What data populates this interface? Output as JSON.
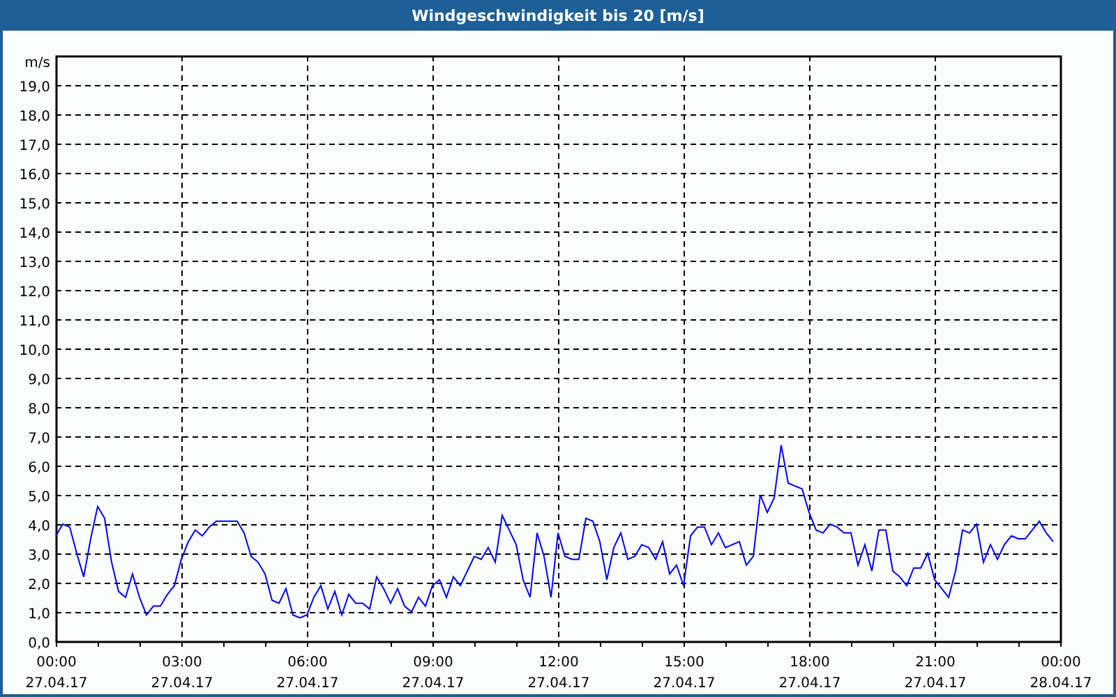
{
  "window": {
    "title": "Windgeschwindigkeit bis 20 [m/s]"
  },
  "chart": {
    "chart_data": {
      "type": "line",
      "grid": true,
      "ylabel": "m/s",
      "ylim": [
        0,
        20
      ],
      "categories": [
        "00:00 27.04.17",
        null,
        null,
        null,
        null,
        null,
        null,
        null,
        null,
        null,
        null,
        null,
        null,
        null,
        null,
        null,
        null,
        null,
        "03:00 27.04.17",
        null,
        null,
        null,
        null,
        null,
        null,
        null,
        null,
        null,
        null,
        null,
        null,
        null,
        null,
        null,
        null,
        null,
        "06:00 27.04.17",
        null,
        null,
        null,
        null,
        null,
        null,
        null,
        null,
        null,
        null,
        null,
        null,
        null,
        null,
        null,
        null,
        null,
        "09:00 27.04.17",
        null,
        null,
        null,
        null,
        null,
        null,
        null,
        null,
        null,
        null,
        null,
        null,
        null,
        null,
        null,
        null,
        null,
        "12:00 27.04.17",
        null,
        null,
        null,
        null,
        null,
        null,
        null,
        null,
        null,
        null,
        null,
        null,
        null,
        null,
        null,
        null,
        null,
        "15:00 27.04.17",
        null,
        null,
        null,
        null,
        null,
        null,
        null,
        null,
        null,
        null,
        null,
        null,
        null,
        null,
        null,
        null,
        null,
        "18:00 27.04.17",
        null,
        null,
        null,
        null,
        null,
        null,
        null,
        null,
        null,
        null,
        null,
        null,
        null,
        null,
        null,
        null,
        null,
        "21:00 27.04.17",
        null,
        null,
        null,
        null,
        null,
        null,
        null,
        null,
        null,
        null,
        null,
        null,
        null,
        null,
        null,
        null,
        null,
        "00:00 28.04.17"
      ],
      "yticks": [
        {
          "value": 0,
          "label": "0,0"
        },
        {
          "value": 1,
          "label": "1,0"
        },
        {
          "value": 2,
          "label": "2,0"
        },
        {
          "value": 3,
          "label": "3,0"
        },
        {
          "value": 4,
          "label": "4,0"
        },
        {
          "value": 5,
          "label": "5,0"
        },
        {
          "value": 6,
          "label": "6,0"
        },
        {
          "value": 7,
          "label": "7,0"
        },
        {
          "value": 8,
          "label": "8,0"
        },
        {
          "value": 9,
          "label": "9,0"
        },
        {
          "value": 10,
          "label": "10,0"
        },
        {
          "value": 11,
          "label": "11,0"
        },
        {
          "value": 12,
          "label": "12,0"
        },
        {
          "value": 13,
          "label": "13,0"
        },
        {
          "value": 14,
          "label": "14,0"
        },
        {
          "value": 15,
          "label": "15,0"
        },
        {
          "value": 16,
          "label": "16,0"
        },
        {
          "value": 17,
          "label": "17,0"
        },
        {
          "value": 18,
          "label": "18,0"
        },
        {
          "value": 19,
          "label": "19,0"
        }
      ],
      "series": [
        {
          "color": "#0000ff",
          "values": [
            3.6,
            4.0,
            3.9,
            3.0,
            2.2,
            3.5,
            4.6,
            4.2,
            2.7,
            1.7,
            1.5,
            2.3,
            1.5,
            0.9,
            1.2,
            1.2,
            1.6,
            1.9,
            2.8,
            3.4,
            3.8,
            3.6,
            3.9,
            4.1,
            4.1,
            4.1,
            4.1,
            3.7,
            2.9,
            2.7,
            2.3,
            1.4,
            1.3,
            1.8,
            0.9,
            0.8,
            0.9,
            1.5,
            1.9,
            1.1,
            1.7,
            0.9,
            1.6,
            1.3,
            1.3,
            1.1,
            2.2,
            1.8,
            1.3,
            1.8,
            1.2,
            1.0,
            1.5,
            1.2,
            1.9,
            2.1,
            1.5,
            2.2,
            1.9,
            2.4,
            2.9,
            2.8,
            3.2,
            2.7,
            4.3,
            3.8,
            3.3,
            2.1,
            1.5,
            3.7,
            2.9,
            1.5,
            3.7,
            2.9,
            2.8,
            2.8,
            4.2,
            4.1,
            3.4,
            2.1,
            3.2,
            3.7,
            2.8,
            2.9,
            3.3,
            3.2,
            2.8,
            3.4,
            2.3,
            2.6,
            1.9,
            3.6,
            3.9,
            3.9,
            3.3,
            3.7,
            3.2,
            3.3,
            3.4,
            2.6,
            2.9,
            5.0,
            4.4,
            4.9,
            6.7,
            5.4,
            5.3,
            5.2,
            4.4,
            3.8,
            3.7,
            4.0,
            3.9,
            3.7,
            3.7,
            2.6,
            3.3,
            2.4,
            3.8,
            3.8,
            2.4,
            2.2,
            1.9,
            2.5,
            2.5,
            3.0,
            2.1,
            1.8,
            1.5,
            2.4,
            3.8,
            3.7,
            4.0,
            2.7,
            3.3,
            2.8,
            3.3,
            3.6,
            3.5,
            3.5,
            3.8,
            4.1,
            3.7,
            3.4,
            null
          ]
        }
      ]
    }
  }
}
